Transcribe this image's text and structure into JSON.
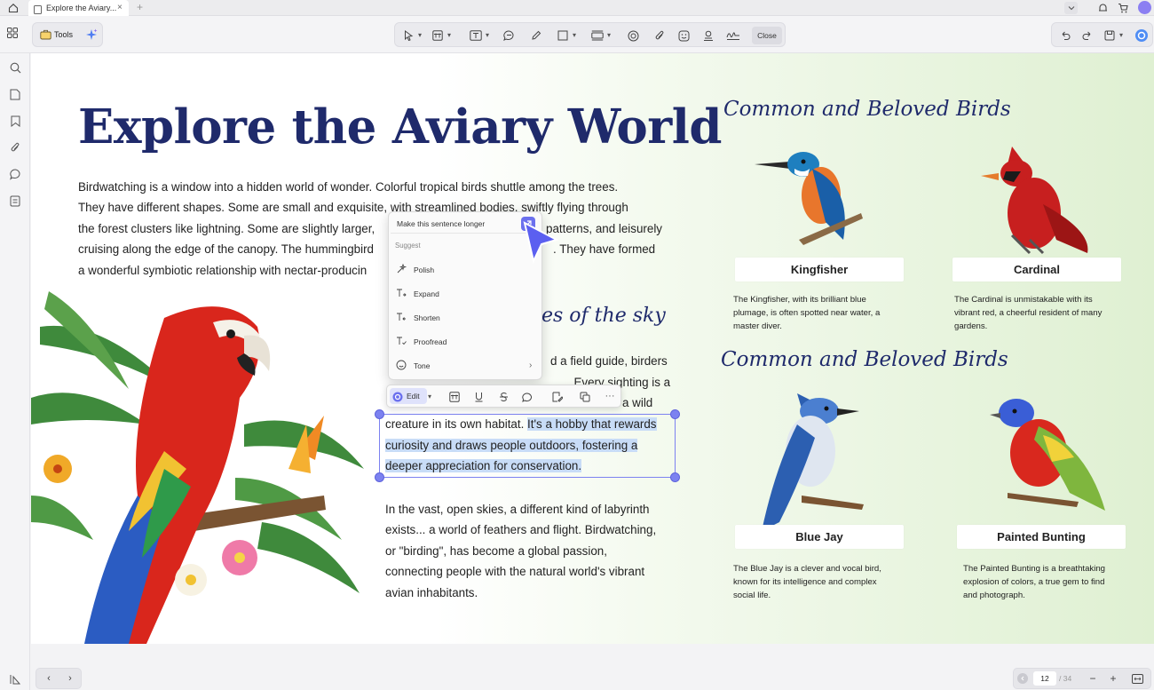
{
  "tab": {
    "title": "Explore the Aviary..."
  },
  "toolbar": {
    "tools_label": "Tools",
    "close_label": "Close"
  },
  "document": {
    "title": "Explore the Aviary World",
    "intro_lines": [
      "Birdwatching is a window into a hidden world of wonder. Colorful tropical birds shuttle among the trees.",
      "They have different shapes. Some are small and exquisite, with streamlined bodies, swiftly flying through",
      "the forest clusters like lightning. Some are slightly larger,",
      "cruising along the edge of the canopy. The hummingbird",
      "a wonderful symbiotic relationship with nectar-producin"
    ],
    "intro_right_1": "patterns, and leisurely",
    "intro_right_2": ". They have formed",
    "sub_heading_partial": "es of the sky",
    "mid_frag_1": "d a field guide, birders",
    "mid_frag_2": ". Every sighting is a",
    "mid_frag_3": "a wild",
    "selected_line_1_a": "creature in its own habitat. ",
    "selected_line_1_b": "It's a hobby that rewards",
    "selected_line_2": "curiosity and draws people outdoors, fostering a",
    "selected_line_3": "deeper appreciation for conservation.",
    "para3_lines": [
      "In the vast, open skies, a different kind of labyrinth",
      "exists... a world of feathers and flight. Birdwatching,",
      "or \"birding\", has become a global passion,",
      "connecting people with the natural world's vibrant",
      "avian inhabitants."
    ],
    "birds_heading_1": "Common and Beloved Birds",
    "birds_heading_2": "Common and Beloved Birds",
    "birds": [
      {
        "name": "Kingfisher",
        "desc": [
          "The Kingfisher, with its brilliant blue",
          "plumage, is often spotted near water, a",
          "master diver."
        ]
      },
      {
        "name": "Cardinal",
        "desc": [
          "The Cardinal is unmistakable with its",
          "vibrant red, a cheerful resident of many",
          "gardens."
        ]
      },
      {
        "name": "Blue Jay",
        "desc": [
          "The Blue Jay is a clever and vocal bird,",
          "known for its intelligence and complex",
          "social life."
        ]
      },
      {
        "name": "Painted Bunting",
        "desc": [
          "The Painted Bunting is a breathtaking",
          "explosion of colors, a true gem to find",
          "and photograph."
        ]
      }
    ]
  },
  "ai_popup": {
    "prompt_value": "Make this sentence longer",
    "suggest_label": "Suggest",
    "items": [
      {
        "label": "Polish",
        "icon": "sparkle-icon"
      },
      {
        "label": "Expand",
        "icon": "expand-text-icon"
      },
      {
        "label": "Shorten",
        "icon": "shorten-text-icon"
      },
      {
        "label": "Proofread",
        "icon": "proofread-icon"
      },
      {
        "label": "Tone",
        "icon": "tone-icon"
      }
    ]
  },
  "edit_bar": {
    "edit_label": "Edit"
  },
  "pagination": {
    "current_page": "12",
    "total": "/ 34"
  },
  "colors": {
    "accent": "#6b70ee",
    "title": "#1f2a6b",
    "highlight": "#c8dcf7"
  }
}
